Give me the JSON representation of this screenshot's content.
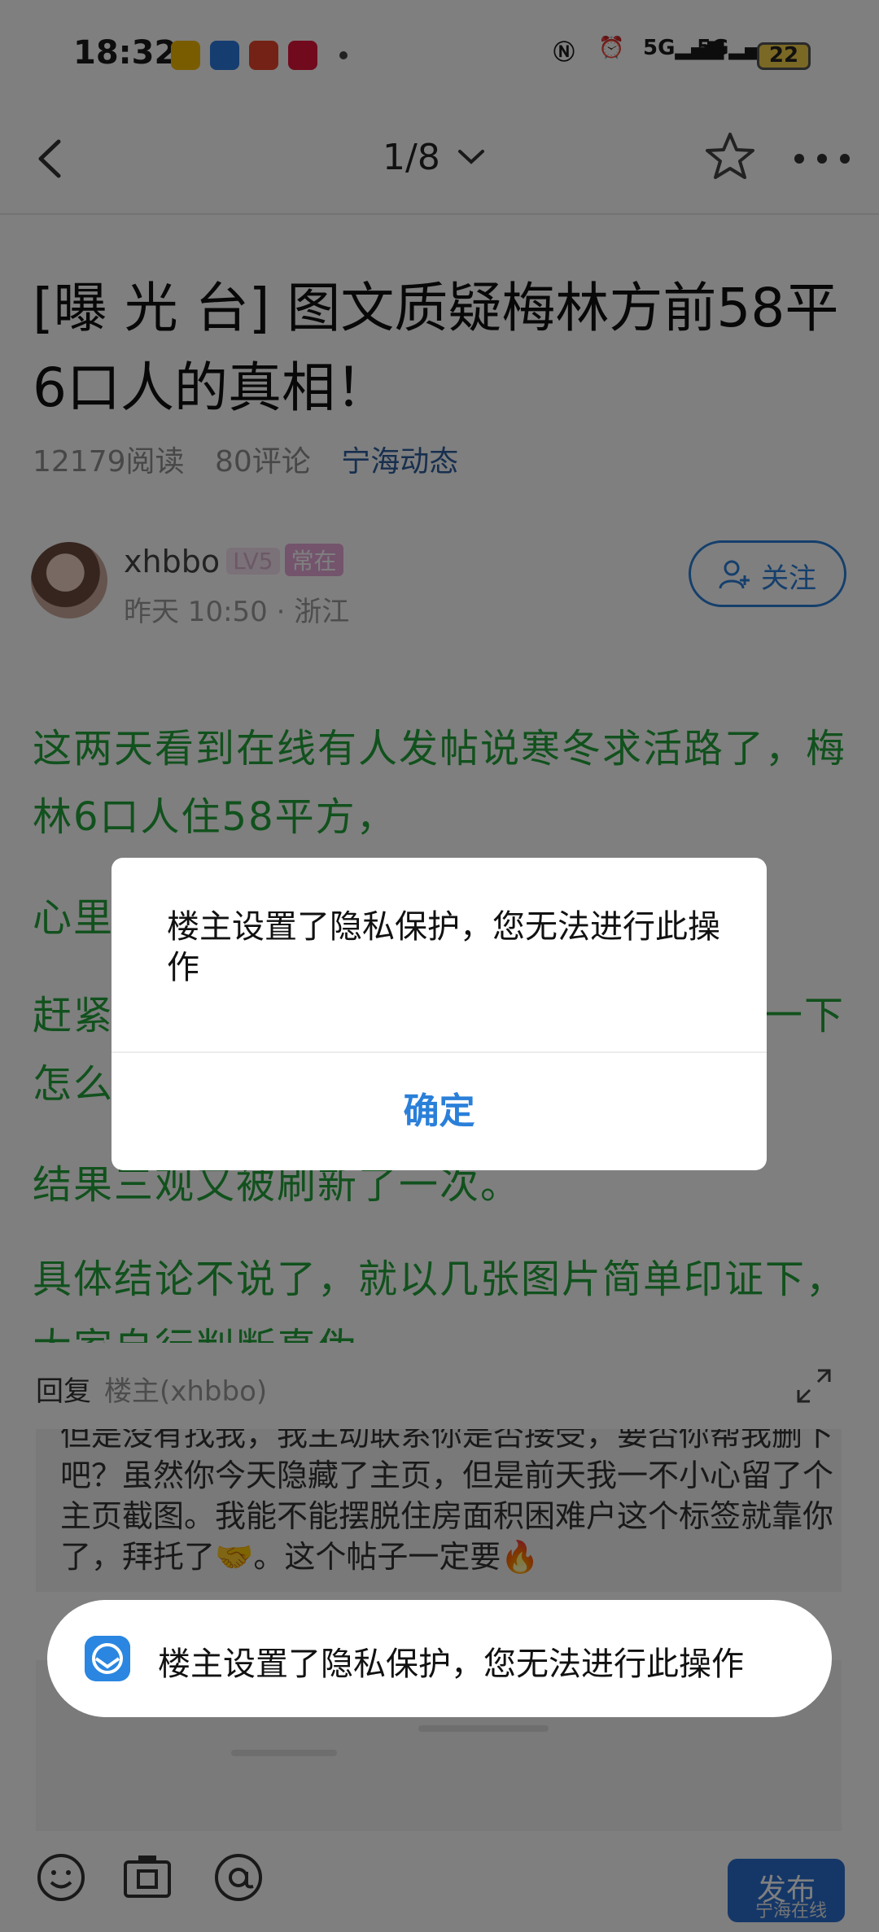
{
  "status_bar": {
    "time": "18:32",
    "network1": "5G",
    "network2": "5G",
    "battery": "22"
  },
  "nav": {
    "page_indicator": "1/8"
  },
  "article": {
    "title": "[曝 光 台] 图文质疑梅林方前58平6口人的真相！",
    "reads": "12179阅读",
    "comments": "80评论",
    "category": "宁海动态",
    "author": "xhbbo",
    "level": "LV5",
    "badge": "常在",
    "post_time": "昨天 10:50 · 浙江",
    "follow_label": "关注",
    "paragraphs": [
      "这两天看到在线有人发帖说寒冬求活路了，梅林6口人住58平方，",
      "心里",
      "赶紧",
      "一下",
      "怎么",
      "结果三观又被刷新了一次。",
      "具体结论不说了，就以几张图片简单印证下，大家自行判断真伪"
    ]
  },
  "reply": {
    "label": "回复",
    "target": "楼主(xhbbo)",
    "draft": "但是没有找我，我主动联系你是否接受，要否你帮我删下吧？虽然你今天隐藏了主页，但是前天我一不小心留了个主页截图。我能不能摆脱住房面积困难户这个标签就靠你了，拜托了🤝。这个帖子一定要🔥",
    "publish_label": "发布"
  },
  "dialog": {
    "message": "楼主设置了隐私保护，您无法进行此操作",
    "confirm_label": "确定"
  },
  "toast": {
    "message": "楼主设置了隐私保护，您无法进行此操作"
  },
  "watermark": "宁海在线",
  "colors": {
    "accent": "#2a7fd9",
    "paragraph_green": "#23a33a",
    "overlay": "rgba(0,0,0,0.5)"
  }
}
